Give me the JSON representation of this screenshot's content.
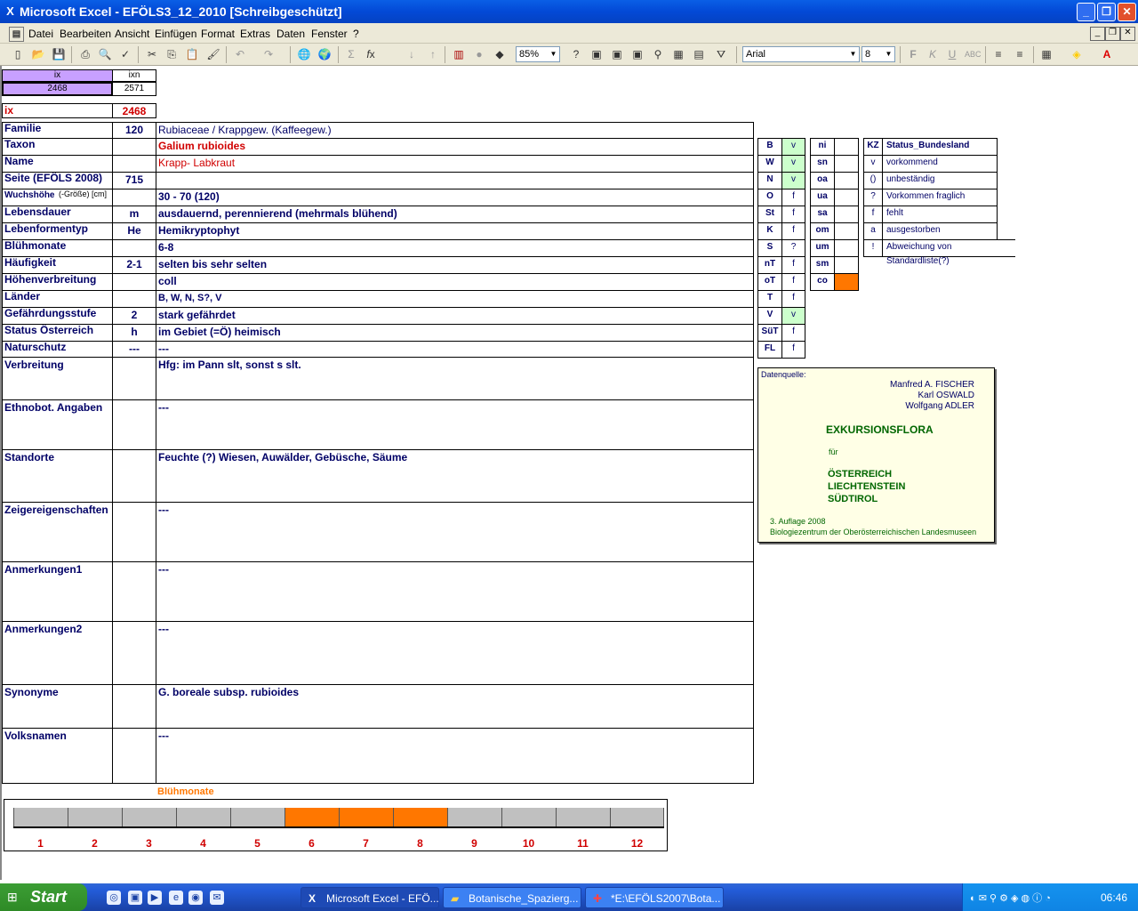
{
  "window": {
    "title": "Microsoft Excel - EFÖLS3_12_2010  [Schreibgeschützt]"
  },
  "menu": [
    "Datei",
    "Bearbeiten",
    "Ansicht",
    "Einfügen",
    "Format",
    "Extras",
    "Daten",
    "Fenster",
    "?"
  ],
  "toolbar": {
    "zoom": "85%",
    "font": "Arial",
    "size": "8"
  },
  "index": {
    "ix_header": "ix",
    "ixn_header": "ixn",
    "ix_value": "2468",
    "ixn_value": "2571",
    "ix_label": "ix",
    "ix_big": "2468"
  },
  "rows": [
    {
      "label": "Familie",
      "code": "120",
      "value": "Rubiaceae  /  Krappgew. (Kaffeegew.)"
    },
    {
      "label": "Taxon",
      "code": "",
      "value": "Galium rubioides"
    },
    {
      "label": "Name",
      "code": "",
      "value": "Krapp- Labkraut"
    },
    {
      "label": "Seite (EFÖLS 2008)",
      "code": "715",
      "value": ""
    },
    {
      "label": "Wuchshöhe",
      "label_suffix": "(-Größe) [cm]",
      "code": "",
      "value": "30 - 70 (120)"
    },
    {
      "label": "Lebensdauer",
      "code": "m",
      "value": "ausdauernd, perennierend (mehrmals blühend)"
    },
    {
      "label": "Lebenformentyp",
      "code": "He",
      "value": "Hemikryptophyt"
    },
    {
      "label": "Blühmonate",
      "code": "",
      "value": "6-8"
    },
    {
      "label": "Häufigkeit",
      "code": "2-1",
      "value": "selten bis sehr selten"
    },
    {
      "label": "Höhenverbreitung",
      "code": "",
      "value": "coll"
    },
    {
      "label": "Länder",
      "code": "",
      "value": "B, W, N, S?, V"
    },
    {
      "label": "Gefährdungsstufe",
      "code": "2",
      "value": "stark gefährdet"
    },
    {
      "label": "Status Österreich",
      "code": "h",
      "value": "im Gebiet (=Ö) heimisch"
    },
    {
      "label": "Naturschutz",
      "code": "---",
      "value": "---"
    }
  ],
  "tall_rows": [
    {
      "label": "Verbreitung",
      "value": "Hfg:  im Pann slt, sonst s slt."
    },
    {
      "label": "Ethnobot. Angaben",
      "value": "---"
    },
    {
      "label": "Standorte",
      "value": "Feuchte (?) Wiesen, Auwälder, Gebüsche, Säume"
    },
    {
      "label": "Zeigereigenschaften",
      "value": "---"
    },
    {
      "label": "Anmerkungen1",
      "value": "---"
    },
    {
      "label": "Anmerkungen2",
      "value": "---"
    },
    {
      "label": "Synonyme",
      "value": "G. boreale subsp. rubioides"
    },
    {
      "label": "Volksnamen",
      "value": "---"
    }
  ],
  "states": [
    {
      "k": "B",
      "v": "v",
      "green": true
    },
    {
      "k": "W",
      "v": "v",
      "green": true
    },
    {
      "k": "N",
      "v": "v",
      "green": true
    },
    {
      "k": "O",
      "v": "f",
      "green": false
    },
    {
      "k": "St",
      "v": "f",
      "green": false
    },
    {
      "k": "K",
      "v": "f",
      "green": false
    },
    {
      "k": "S",
      "v": "?",
      "green": false
    },
    {
      "k": "nT",
      "v": "f",
      "green": false
    },
    {
      "k": "oT",
      "v": "f",
      "green": false
    },
    {
      "k": "T",
      "v": "f",
      "green": false
    },
    {
      "k": "V",
      "v": "v",
      "green": true
    },
    {
      "k": "SüT",
      "v": "f",
      "green": false
    },
    {
      "k": "FL",
      "v": "f",
      "green": false
    }
  ],
  "altitude": [
    {
      "k": "ni",
      "v": ""
    },
    {
      "k": "sn",
      "v": ""
    },
    {
      "k": "oa",
      "v": ""
    },
    {
      "k": "ua",
      "v": ""
    },
    {
      "k": "sa",
      "v": ""
    },
    {
      "k": "om",
      "v": ""
    },
    {
      "k": "um",
      "v": ""
    },
    {
      "k": "sm",
      "v": ""
    },
    {
      "k": "co",
      "v": "",
      "orange": true
    }
  ],
  "status_legend": {
    "kz": "KZ",
    "title": "Status_Bundesland",
    "items": [
      {
        "k": "v",
        "t": "vorkommend"
      },
      {
        "k": "()",
        "t": "unbeständig"
      },
      {
        "k": "?",
        "t": "Vorkommen fraglich"
      },
      {
        "k": "f",
        "t": "fehlt"
      },
      {
        "k": "a",
        "t": "ausgestorben"
      },
      {
        "k": "!",
        "t": "Abweichung von Standardliste(?)"
      }
    ]
  },
  "source": {
    "label": "Datenquelle:",
    "authors": [
      "Manfred A. FISCHER",
      "Karl OSWALD",
      "Wolfgang ADLER"
    ],
    "title": "EXKURSIONSFLORA",
    "fuer": "für",
    "countries": [
      "ÖSTERREICH",
      "LIECHTENSTEIN",
      "SÜDTIROL"
    ],
    "edition": "3. Auflage 2008",
    "publisher": "Biologiezentrum der Oberösterreichischen Landesmuseen"
  },
  "bloom": {
    "title": "Blühmonate",
    "months": [
      "1",
      "2",
      "3",
      "4",
      "5",
      "6",
      "7",
      "8",
      "9",
      "10",
      "11",
      "12"
    ],
    "active": [
      6,
      7,
      8
    ],
    "color_active": "#ff7700",
    "color_inactive": "#c0c0c0"
  },
  "taskbar": {
    "start": "Start",
    "tasks": [
      "Microsoft Excel - EFÖ...",
      "Botanische_Spazierg...",
      "*E:\\EFÖLS2007\\Bota..."
    ],
    "time": "06:46"
  }
}
